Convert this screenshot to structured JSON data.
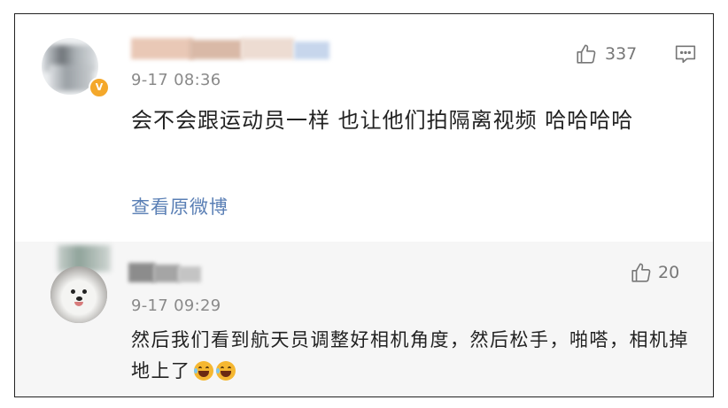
{
  "main_comment": {
    "username": "",
    "timestamp": "9-17 08:36",
    "content": "会不会跟运动员一样 也让他们拍隔离视频 哈哈哈哈",
    "like_count": "337",
    "view_original_label": "查看原微博",
    "verified_badge": "V"
  },
  "reply_comment": {
    "username": "",
    "timestamp": "9-17 09:29",
    "content": "然后我们看到航天员调整好相机角度，然后松手，啪嗒，相机掉地上了",
    "like_count": "20",
    "emojis": [
      "laughing-crying-emoji",
      "laughing-crying-emoji"
    ]
  },
  "icons": {
    "like": "thumbs-up-icon",
    "reply": "comment-bubble-icon"
  },
  "colors": {
    "link": "#5a7fb5",
    "timestamp": "#8a8a8a",
    "badge": "#f4a82b",
    "reply_background": "#f6f6f6"
  }
}
